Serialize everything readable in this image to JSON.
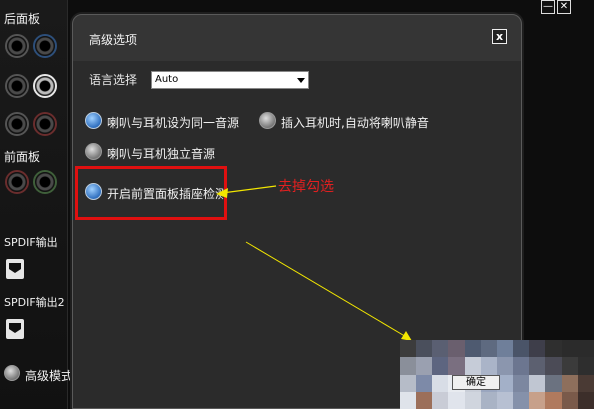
{
  "sidebar": {
    "rear_panel_label": "后面板",
    "front_panel_label": "前面板",
    "spdif_out_label": "SPDIF输出",
    "spdif_out2_label": "SPDIF输出2",
    "advanced_mode_label": "高级模式"
  },
  "window_controls": {
    "minimize": "—",
    "close": "✕"
  },
  "dialog": {
    "title": "高级选项",
    "close_label": "x",
    "language_label": "语言选择",
    "language_value": "Auto",
    "options": {
      "same_source": "喇叭与耳机设为同一音源",
      "mute_on_plug": "插入耳机时,自动将喇叭静音",
      "independent_source": "喇叭与耳机独立音源",
      "front_jack_detection": "开启前置面板插座检测"
    },
    "ok_button": "确定"
  },
  "annotation": {
    "text": "去掉勾选",
    "color": "#e02020"
  },
  "colors": {
    "dialog_bg": "#353535",
    "content_bg": "#2b2b2b",
    "highlight": "#e01010",
    "arrow_yellow": "#f2e600"
  }
}
